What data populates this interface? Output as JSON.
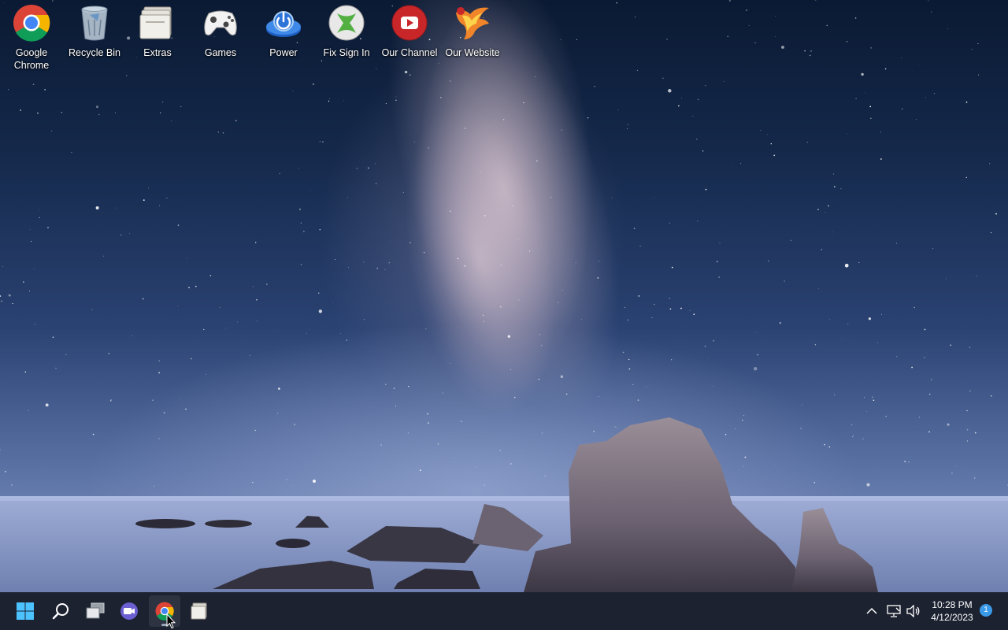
{
  "desktop": {
    "icons": [
      {
        "label": "Google Chrome",
        "icon": "chrome-icon"
      },
      {
        "label": "Recycle Bin",
        "icon": "recycle-bin-icon"
      },
      {
        "label": "Extras",
        "icon": "folder-icon"
      },
      {
        "label": "Games",
        "icon": "gamepad-icon"
      },
      {
        "label": "Power",
        "icon": "power-icon"
      },
      {
        "label": "Fix Sign In",
        "icon": "xbox-icon"
      },
      {
        "label": "Our Channel",
        "icon": "youtube-icon"
      },
      {
        "label": "Our Website",
        "icon": "phoenix-logo-icon"
      }
    ]
  },
  "taskbar": {
    "items": [
      {
        "name": "start-button",
        "icon": "windows-logo-icon"
      },
      {
        "name": "search-button",
        "icon": "search-icon"
      },
      {
        "name": "task-view-button",
        "icon": "task-view-icon"
      },
      {
        "name": "teams-chat-button",
        "icon": "video-chat-icon"
      },
      {
        "name": "chrome-taskbar-button",
        "icon": "chrome-icon",
        "active": true
      },
      {
        "name": "file-explorer-button",
        "icon": "folder-icon"
      }
    ],
    "tray": {
      "time": "10:28 PM",
      "date": "4/12/2023",
      "notification_count": "1"
    }
  },
  "colors": {
    "taskbar_bg": "#1c2230",
    "accent": "#3b9ae8"
  }
}
